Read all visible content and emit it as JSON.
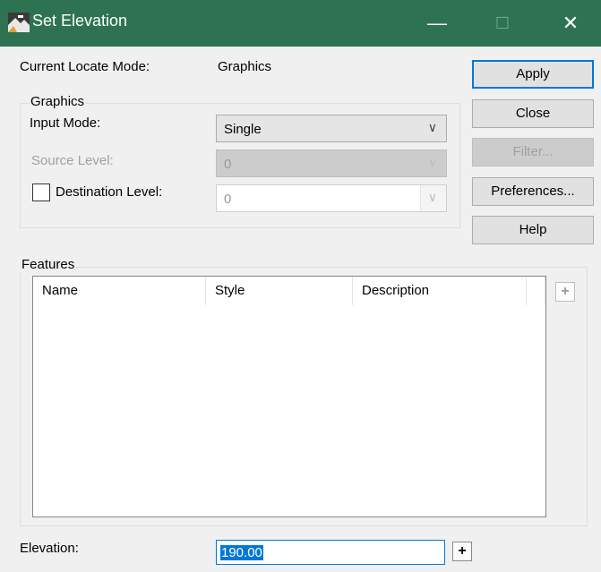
{
  "window": {
    "title": "Set Elevation",
    "minimize_glyph": "—",
    "maximize_glyph": "☐",
    "close_glyph": "✕",
    "accent": "#2d7352"
  },
  "locate": {
    "label": "Current Locate Mode:",
    "value": "Graphics"
  },
  "graphics_group": {
    "legend": "Graphics",
    "input_mode_label": "Input Mode:",
    "input_mode_value": "Single",
    "source_level_label": "Source Level:",
    "source_level_value": "0",
    "destination_level_label": "Destination Level:",
    "destination_level_value": "0",
    "destination_checked": false
  },
  "buttons": {
    "apply": "Apply",
    "close": "Close",
    "filter": "Filter...",
    "preferences": "Preferences...",
    "help": "Help"
  },
  "features": {
    "legend": "Features",
    "columns": [
      "Name",
      "Style",
      "Description"
    ],
    "rows": []
  },
  "elevation": {
    "label": "Elevation:",
    "value": "190.00"
  },
  "icons": {
    "pick_glyph": "+",
    "dropdown_glyph": "∨"
  }
}
